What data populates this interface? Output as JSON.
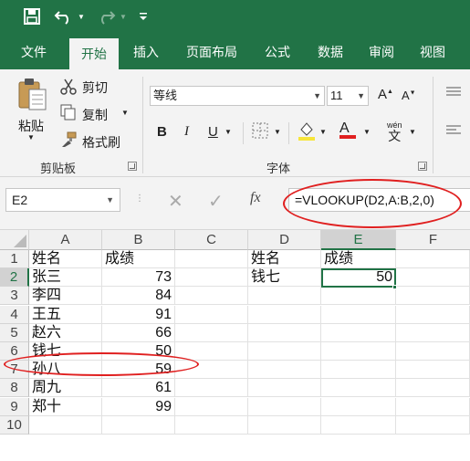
{
  "app": {
    "accent": "#217346",
    "highlight": "#e02020"
  },
  "quick_access": {
    "icons": [
      "save-icon",
      "undo-icon",
      "redo-icon",
      "customize-icon"
    ]
  },
  "tabs": [
    {
      "label": "文件",
      "active": false
    },
    {
      "label": "开始",
      "active": true
    },
    {
      "label": "插入",
      "active": false
    },
    {
      "label": "页面布局",
      "active": false
    },
    {
      "label": "公式",
      "active": false
    },
    {
      "label": "数据",
      "active": false
    },
    {
      "label": "审阅",
      "active": false
    },
    {
      "label": "视图",
      "active": false
    }
  ],
  "clipboard": {
    "paste": "粘贴",
    "cut": "剪切",
    "copy": "复制",
    "format_painter": "格式刷",
    "group": "剪贴板"
  },
  "font": {
    "name": "等线",
    "size": "11",
    "group": "字体",
    "bold": "B",
    "italic": "I",
    "underline": "U",
    "font_color_letter": "A",
    "phonetic": "wén"
  },
  "formula_bar": {
    "name_box": "E2",
    "fx": "fx",
    "formula": "=VLOOKUP(D2,A:B,2,0)"
  },
  "sheet": {
    "columns": [
      "A",
      "B",
      "C",
      "D",
      "E",
      "F"
    ],
    "selected_column": "E",
    "rows": [
      "1",
      "2",
      "3",
      "4",
      "5",
      "6",
      "7",
      "8",
      "9",
      "10"
    ],
    "selected_row": "2",
    "active_cell": "E2",
    "data": [
      {
        "a": "姓名",
        "b": "成绩",
        "d": "姓名",
        "e": "成绩"
      },
      {
        "a": "张三",
        "b": "73",
        "d": "钱七",
        "e": "50"
      },
      {
        "a": "李四",
        "b": "84"
      },
      {
        "a": "王五",
        "b": "91"
      },
      {
        "a": "赵六",
        "b": "66"
      },
      {
        "a": "钱七",
        "b": "50"
      },
      {
        "a": "孙八",
        "b": "59"
      },
      {
        "a": "周九",
        "b": "61"
      },
      {
        "a": "郑十",
        "b": "99"
      },
      {}
    ]
  }
}
